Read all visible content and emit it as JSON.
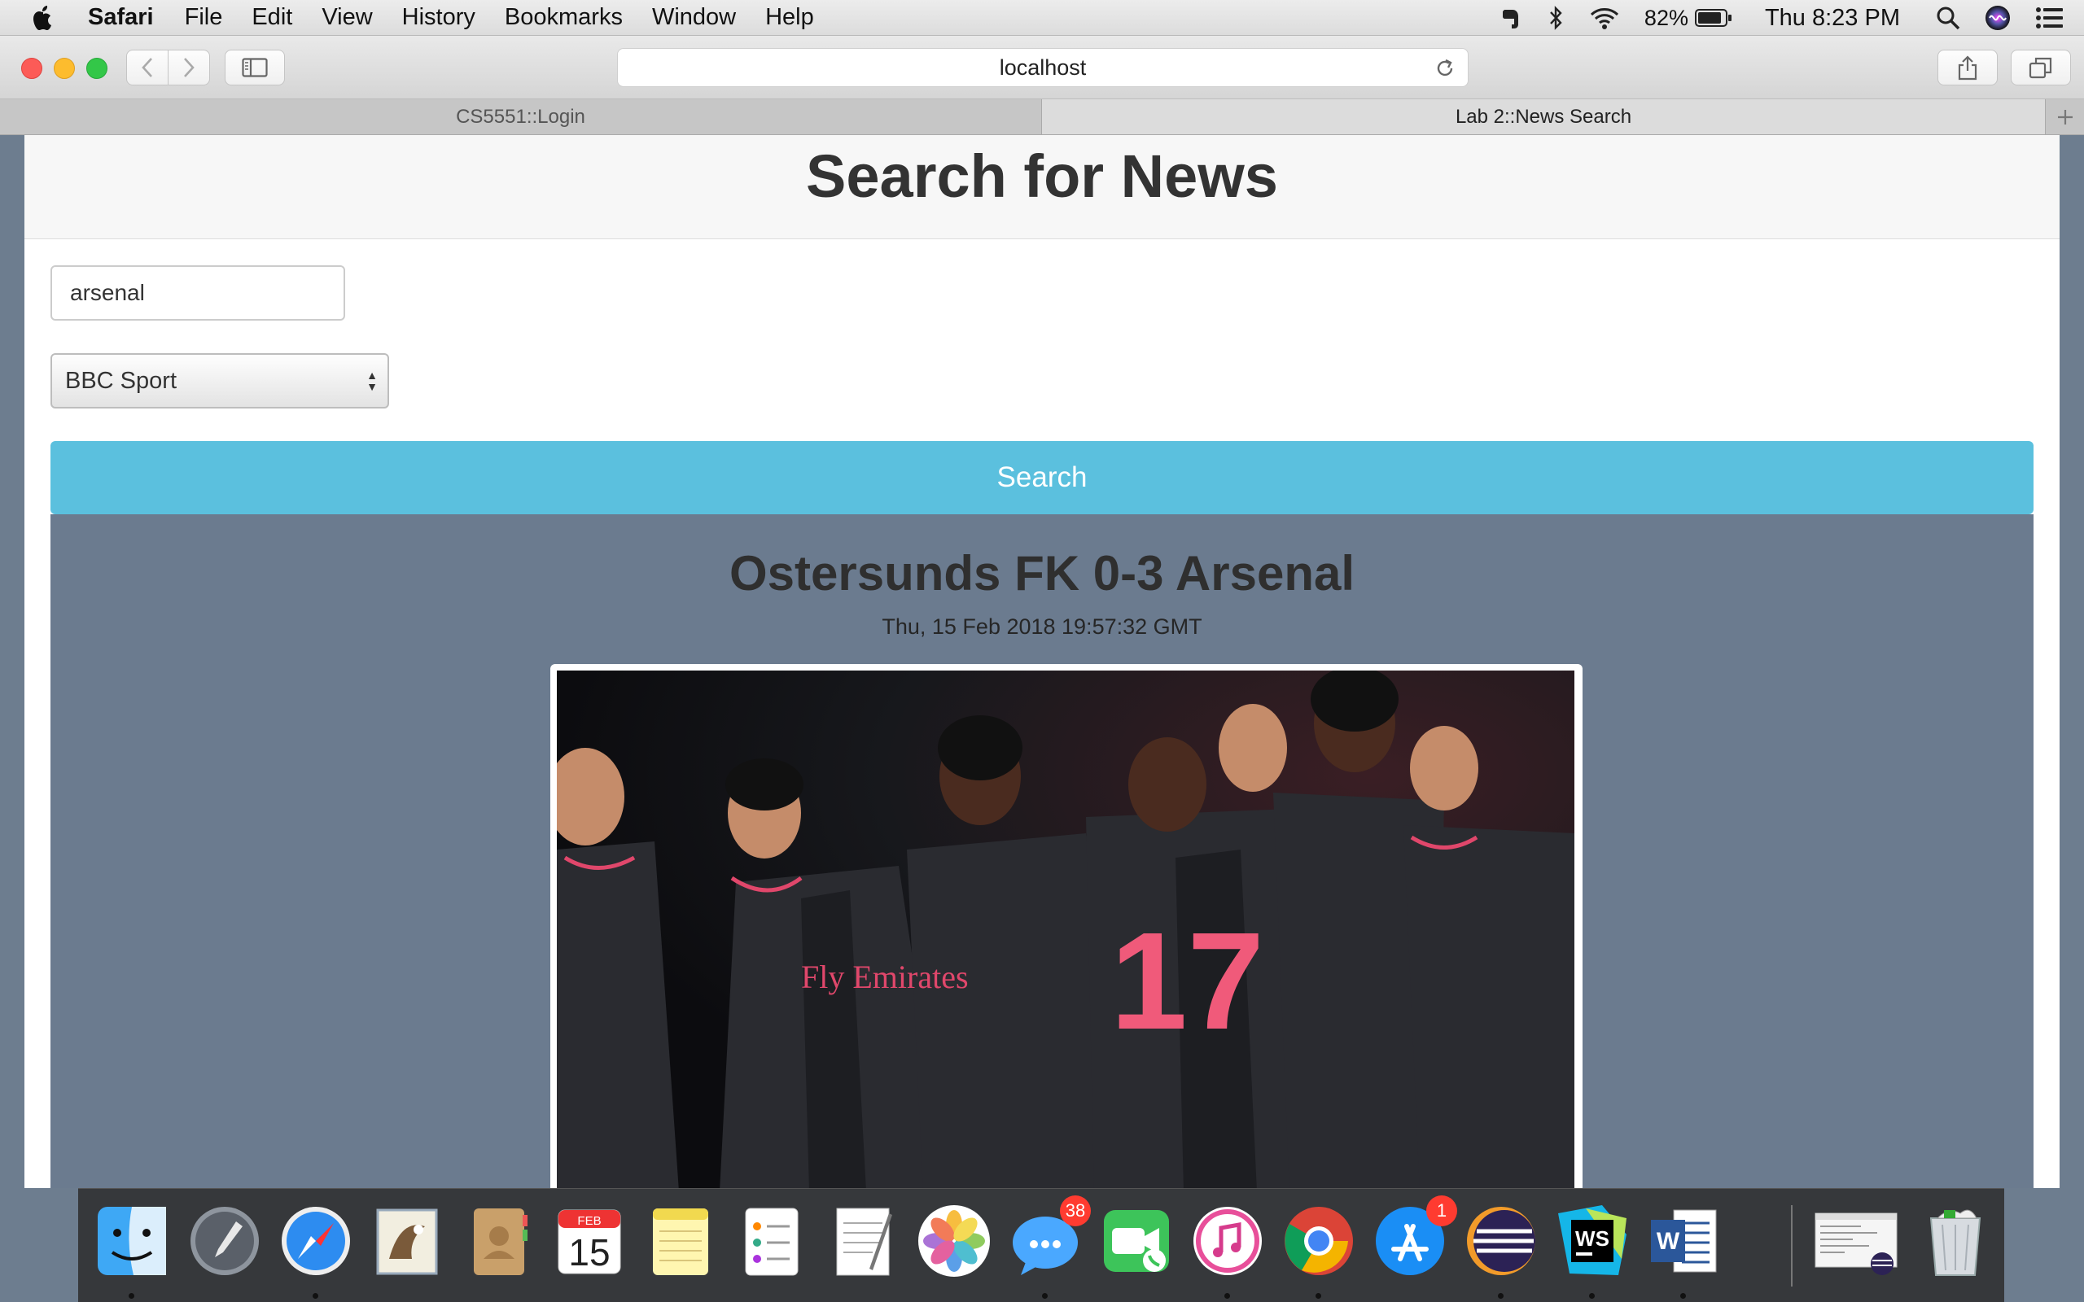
{
  "menubar": {
    "app_name": "Safari",
    "menus": [
      "File",
      "Edit",
      "View",
      "History",
      "Bookmarks",
      "Window",
      "Help"
    ],
    "battery_percent": "82%",
    "clock": "Thu 8:23 PM"
  },
  "browser": {
    "address": "localhost",
    "tabs": [
      {
        "label": "CS5551::Login",
        "active": false
      },
      {
        "label": "Lab 2::News Search",
        "active": true
      }
    ]
  },
  "page": {
    "heading": "Search for News",
    "search_value": "arsenal",
    "source_selected": "BBC Sport",
    "search_button": "Search",
    "article": {
      "title": "Ostersunds FK 0-3 Arsenal",
      "date": "Thu, 15 Feb 2018 19:57:32 GMT",
      "jersey_sponsor": "Fly Emirates",
      "jersey_number": "17"
    }
  },
  "dock": {
    "calendar_month": "FEB",
    "calendar_day": "15",
    "messages_badge": "38",
    "appstore_badge": "1",
    "webstorm_label": "WS",
    "word_label": "W"
  }
}
